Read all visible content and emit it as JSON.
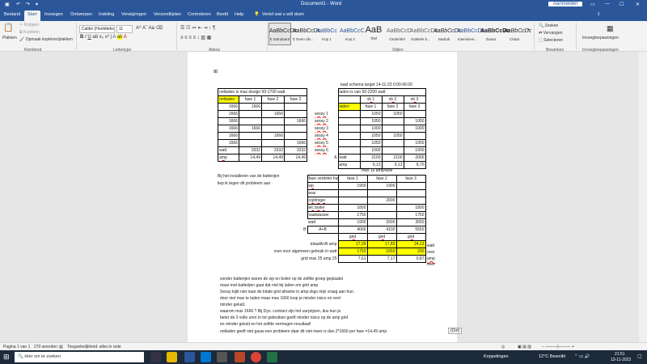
{
  "window": {
    "title": "Document1 - Word",
    "user": "Aanmelden"
  },
  "tabs": [
    "Bestand",
    "Start",
    "Invoegen",
    "Ontwerpen",
    "Indeling",
    "Verwijzingen",
    "Verzendlijsten",
    "Controleren",
    "Beeld",
    "Help",
    "Vertel wat u wilt doen"
  ],
  "ribbon": {
    "clipboard": {
      "paste": "Plakken",
      "cut": "Knippen",
      "copy": "Kopiëren",
      "painter": "Opmaak kopiëren/plakken",
      "group": "Klembord"
    },
    "font": {
      "name": "Calibri (Hoofdtekst)",
      "size": "11",
      "group": "Lettertype"
    },
    "paragraph": {
      "group": "Alinea"
    },
    "styles": {
      "group": "Stijlen",
      "items": [
        {
          "preview": "AaBbCcDc",
          "name": "¶ Standaard"
        },
        {
          "preview": "AaBbCcDc",
          "name": "¶ Geen afs..."
        },
        {
          "preview": "AaBbCc",
          "name": "Kop 1"
        },
        {
          "preview": "AaBbCcC",
          "name": "Kop 2"
        },
        {
          "preview": "AaB",
          "name": "Titel"
        },
        {
          "preview": "AaBbCcD",
          "name": "Ondertitel"
        },
        {
          "preview": "AaBbCcDc",
          "name": "Subtiele b..."
        },
        {
          "preview": "AaBbCcDc",
          "name": "Nadruk"
        },
        {
          "preview": "AaBbCcDc",
          "name": "Intensieve..."
        },
        {
          "preview": "AaBbCcDc",
          "name": "Zwaar"
        },
        {
          "preview": "AaBbCcDc",
          "name": "Citaat"
        }
      ]
    },
    "editing": {
      "find": "Zoeken",
      "replace": "Vervangen",
      "select": "Selecteren",
      "group": "Bewerken"
    },
    "addins": {
      "label": "Invoegtoepassingen",
      "group": "Invoegtoepassingen"
    }
  },
  "doc": {
    "table1": [
      [
        "ontladen is max design 50-1700 watt",
        "",
        "",
        ""
      ],
      [
        "ontladen",
        "fase 1",
        "fase 2",
        "fase 3"
      ],
      [
        "1666",
        "1666",
        "",
        ""
      ],
      [
        "1666",
        "",
        "1666",
        ""
      ],
      [
        "1666",
        "",
        "",
        "1666"
      ],
      [
        "1666",
        "1666",
        "",
        ""
      ],
      [
        "1666",
        "",
        "1666",
        ""
      ],
      [
        "1666",
        "",
        "",
        "1666"
      ],
      [
        "watt",
        "3332",
        "3332",
        "3332"
      ],
      [
        "amp",
        "14,49",
        "14,49",
        "14,49"
      ]
    ],
    "schema_title": "laad schema target 14-11-23  0:00-06:00",
    "table2": [
      [
        "",
        "laden is van 50-2200 watt",
        "",
        "",
        ""
      ],
      [
        "",
        "",
        "vb 1",
        "vb 2",
        "vb 3"
      ],
      [
        "",
        "laden",
        "fase 1",
        "fase 2",
        "fase 3"
      ],
      [
        "sessy 1",
        "",
        "1050",
        "1050",
        ""
      ],
      [
        "sessy 2",
        "",
        "1050",
        "",
        "1050"
      ],
      [
        "sessy 3",
        "",
        "1000",
        "",
        "1000"
      ],
      [
        "sessy 4",
        "",
        "1050",
        "1050",
        ""
      ],
      [
        "sessy 5",
        "",
        "1050",
        "",
        "1050"
      ],
      [
        "sessy 6",
        "",
        "1000",
        "",
        "1000"
      ],
      [
        "A",
        "watt",
        "2100",
        "2100",
        "2000"
      ],
      [
        "",
        "amp",
        "9,13",
        "9,13",
        "8,70"
      ]
    ],
    "max_line": "max 16 amp/fase",
    "table3": [
      [
        "",
        "fase verdeler huis",
        "fase 1",
        "fase 2",
        "fase 3"
      ],
      [
        "",
        "wp",
        "1900",
        "1900",
        ""
      ],
      [
        "",
        "was",
        "",
        "",
        ""
      ],
      [
        "",
        "cq/droger",
        "",
        "2000",
        ""
      ],
      [
        "",
        "elc boiler",
        "1800",
        "",
        "1800"
      ],
      [
        "",
        "vaatwasser",
        "1750",
        "",
        "1750"
      ],
      [
        "",
        "watt",
        "1900",
        "2000",
        "3550"
      ],
      [
        "B",
        "A+B",
        "4000",
        "4100",
        "5550"
      ],
      [
        "",
        "",
        "grid",
        "grid",
        "grid"
      ],
      [
        "",
        "totaalA+B  amp",
        "17,39",
        "17,83",
        "24,13"
      ],
      [
        "",
        "over voor algemeen gebruik  in watt",
        "1750",
        "1650",
        "200"
      ],
      [
        "",
        "grid   max 25 amp   25",
        "7,61",
        "7,17",
        "0,87"
      ]
    ],
    "side_notes": [
      "watt",
      "over",
      "amp",
      "over"
    ],
    "note_left": [
      "Bij het installeren van de batterijen",
      "liep ik tegen dit probleem aan ."
    ],
    "paragraph": [
      "zonder batterijen waren de wp en boiler op de zelfde groep geplaatst",
      "maar met batterijen gaat dat niet bij laden om grid amp",
      "Sessy kijkt niet naar de totale grid afname in amp.vkgs mijn vraag aan hun.",
      "door niet max te laden maar max 1666 loop je minder risico en veel",
      "minder geluid.",
      "waarom max 1666 ? Bij Dyn. contract zijn het uurprijzen, dus kun je",
      "beter de 3 volle uren in tot gebruiken geeft minder risico op de amp grid",
      "en minder geluid en het zelfde vermogen resultaat!",
      "ontladen geeft niet gauw een probleem daar dit niet meer is dan 2*1666 per fase =14,49 amp"
    ],
    "paste_ctrl": "(Ctrl)"
  },
  "status": {
    "page": "Pagina 1 van 1",
    "words": "270 woorden",
    "accessibility": "Toegankelijkheid: alles in orde"
  },
  "taskbar": {
    "search": "Hier om te zoeken",
    "links": "Koppelingen",
    "weather": "12°C  Bewolkt",
    "time": "21:51",
    "date": "13-11-2023"
  }
}
